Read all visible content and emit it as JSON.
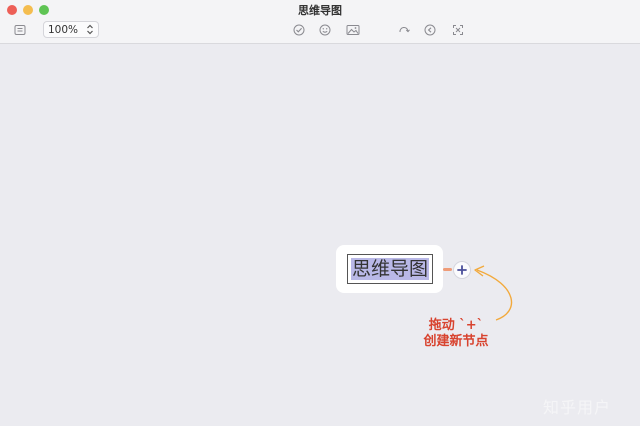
{
  "window": {
    "title": "思维导图"
  },
  "toolbar": {
    "outline_icon": "outline-icon",
    "zoom_value": "100%",
    "tools": [
      "task-icon",
      "emoji-icon",
      "image-icon",
      "undo-icon",
      "prev-icon",
      "fullscreen-icon"
    ]
  },
  "canvas": {
    "central_topic": "思维导图",
    "add_button": "+",
    "hint_line1": "拖动 `+`",
    "hint_line2": "创建新节点"
  },
  "watermark": "知乎用户",
  "colors": {
    "background": "#ebebf0",
    "selection": "#b9b8e7",
    "connector": "#ef9c78",
    "arrow": "#f2a93b",
    "hint": "#d8432f",
    "plus": "#4b4f9a"
  }
}
